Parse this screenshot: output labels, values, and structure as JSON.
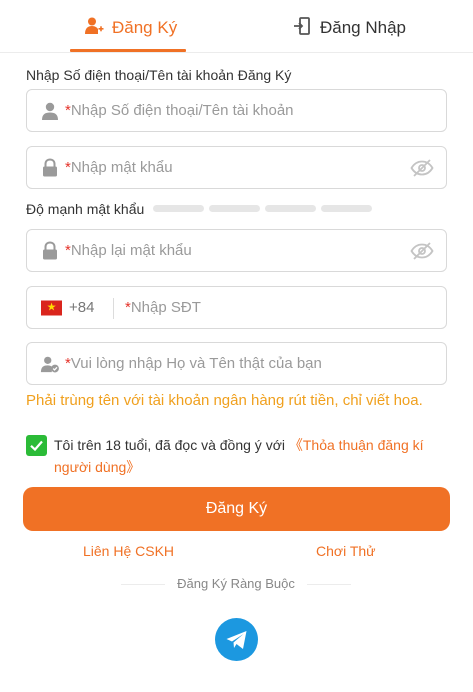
{
  "tabs": {
    "register_label": "Đăng Ký",
    "login_label": "Đăng Nhập",
    "active": "register"
  },
  "form": {
    "section_label": "Nhập Số điện thoại/Tên tài khoản Đăng Ký",
    "account_placeholder": "Nhập Số điện thoại/Tên tài khoản",
    "password_placeholder": "Nhập mật khẩu",
    "strength_label": "Độ mạnh mật khẩu",
    "strength_level": 0,
    "strength_segments": 4,
    "confirm_placeholder": "Nhập lại mật khẩu",
    "country_code": "+84",
    "phone_placeholder": "Nhập SĐT",
    "name_placeholder": "Vui lòng nhập Họ và Tên thật của bạn",
    "required_mark": "*",
    "name_warning": "Phải trùng tên với tài khoản ngân hàng rút tiền, chỉ viết hoa."
  },
  "agreement": {
    "checked": true,
    "text": "Tôi trên 18 tuổi, đã đọc và đồng ý với ",
    "link": "《Thỏa thuận đăng kí người dùng》"
  },
  "actions": {
    "submit_label": "Đăng Ký",
    "support_label": "Liên Hệ CSKH",
    "try_label": "Chơi Thử",
    "bind_label": "Đăng Ký Ràng Buộc"
  },
  "colors": {
    "accent": "#f07125",
    "warning": "#f0a01e",
    "check": "#2bbb37",
    "telegram": "#1c98e0",
    "required": "#e5342b"
  },
  "icons": {
    "register_tab": "add-user-icon",
    "login_tab": "login-door-icon",
    "account": "user-icon",
    "password": "lock-icon",
    "visibility": "eye-off-icon",
    "flag": "vietnam-flag-icon",
    "name": "user-verified-icon",
    "social": "telegram-icon"
  }
}
